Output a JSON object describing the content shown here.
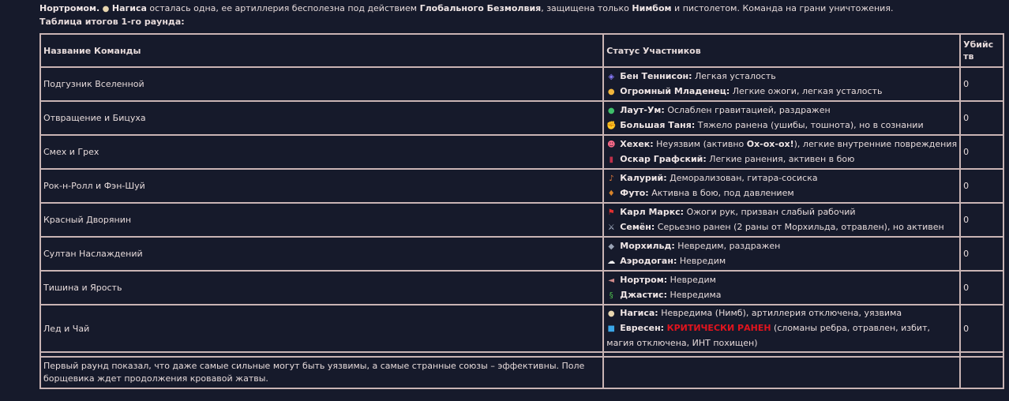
{
  "intro": {
    "lead_name": "Нортромом.",
    "icon": "lemon-icon",
    "name": "Нагиса",
    "text1": " осталась одна, ее артиллерия бесполезна под действием ",
    "spell": "Глобального Безмолвия",
    "text2": ", защищена только ",
    "shield": "Нимбом",
    "text3": " и пистолетом. Команда на грани уничтожения."
  },
  "caption": "Таблица итогов 1-го раунда:",
  "table": {
    "headers": {
      "team": "Название Команды",
      "status": "Статус Участников",
      "kills": "Убийс тв"
    },
    "rows": [
      {
        "team": "Подгузник Вселенной",
        "kills": "0",
        "members": [
          {
            "icon": "omnitrix-icon",
            "glyph": "◈",
            "color": "#8a7cff",
            "name": "Бен Теннисон",
            "status": "Легкая усталость"
          },
          {
            "icon": "baby-face-icon",
            "glyph": "●",
            "color": "#f2b63c",
            "name": "Огромный Младенец",
            "status": "Легкие ожоги, легкая усталость"
          }
        ]
      },
      {
        "team": "Отвращение и Бицуха",
        "kills": "0",
        "members": [
          {
            "icon": "alien-face-icon",
            "glyph": "●",
            "color": "#3fbf6a",
            "name": "Лаут-Ум",
            "status": "Ослаблен гравитацией, раздражен"
          },
          {
            "icon": "flexed-biceps-icon",
            "glyph": "✊",
            "color": "#f2b63c",
            "name": "Большая Таня",
            "status": "Тяжело ранена (ушибы, тошнота), но в сознании"
          }
        ]
      },
      {
        "team": "Смех и Грех",
        "kills": "0",
        "members": [
          {
            "icon": "clown-face-icon",
            "glyph": "☻",
            "color": "#ff6b8a",
            "name": "Хехек",
            "status": "Неуязвим (активно ",
            "status_bold": "Ох-ох-ох!",
            "status_after": "), легкие внутренние повреждения"
          },
          {
            "icon": "top-hat-icon",
            "glyph": "▮",
            "color": "#c0304a",
            "name": "Оскар Графский",
            "status": "Легкие ранения, активен в бою"
          }
        ]
      },
      {
        "team": "Рок-н-Ролл и Фэн-Шуй",
        "kills": "0",
        "members": [
          {
            "icon": "guitar-icon",
            "glyph": "♪",
            "color": "#e07a3a",
            "name": "Калурий",
            "status": "Деморализован, гитара-сосиска"
          },
          {
            "icon": "flame-icon",
            "glyph": "♦",
            "color": "#d9842a",
            "name": "Футо",
            "status": "Активна в бою, под давлением"
          }
        ]
      },
      {
        "team": "Красный Дворянин",
        "kills": "0",
        "members": [
          {
            "icon": "red-flag-icon",
            "glyph": "⚑",
            "color": "#e03030",
            "name": "Карл Маркс",
            "status": "Ожоги рук, призван слабый рабочий"
          },
          {
            "icon": "crossed-swords-icon",
            "glyph": "⚔",
            "color": "#b8c4d8",
            "name": "Семён",
            "status": "Серьезно ранен (2 раны от Морхильда, отравлен), но активен"
          }
        ]
      },
      {
        "team": "Султан Наслаждений",
        "kills": "0",
        "members": [
          {
            "icon": "wolf-icon",
            "glyph": "◆",
            "color": "#9aa3b5",
            "name": "Морхильд",
            "status": "Невредим, раздражен"
          },
          {
            "icon": "cloud-icon",
            "glyph": "☁",
            "color": "#f2f2f2",
            "name": "Аэродоган",
            "status": "Невредим"
          }
        ]
      },
      {
        "team": "Тишина и Ярость",
        "kills": "0",
        "members": [
          {
            "icon": "muted-speaker-icon",
            "glyph": "◄",
            "color": "#d08a8a",
            "name": "Нортром",
            "status": "Невредим"
          },
          {
            "icon": "snake-icon",
            "glyph": "§",
            "color": "#4fc24f",
            "name": "Джастис",
            "status": "Невредима"
          }
        ]
      },
      {
        "team": "Лед и Чай",
        "kills": "0",
        "members": [
          {
            "icon": "lemon-icon",
            "glyph": "●",
            "color": "#e8d6b0",
            "name": "Нагиса",
            "status": "Невредима (Нимб), артиллерия отключена, уязвима"
          },
          {
            "icon": "ice-cube-icon",
            "glyph": "■",
            "color": "#3aa6e8",
            "name": "Евресен",
            "status_crit": "КРИТИЧЕСКИ РАНЕН",
            "status": " (сломаны ребра, отравлен, избит, магия отключена, ИНТ похищен)"
          }
        ]
      }
    ],
    "summary": "Первый раунд показал, что даже самые сильные могут быть уязвимы, а самые странные союзы – эффективны. Поле борщевика ждет продолжения кровавой жатвы."
  },
  "colors": {
    "background": "#161a2b",
    "text": "#e6dada",
    "border": "#c9b4b4",
    "critical": "#e0141e"
  }
}
